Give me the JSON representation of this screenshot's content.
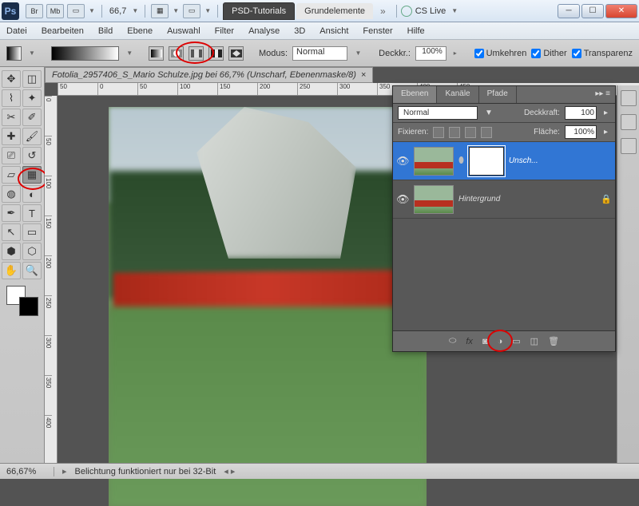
{
  "app": {
    "logo": "Ps"
  },
  "titlebar": {
    "boxes": [
      "Br",
      "Mb"
    ],
    "zoom": "66,7",
    "tabs": {
      "dark": "PSD-Tutorials",
      "light": "Grundelemente"
    },
    "cslive": "CS Live"
  },
  "menu": [
    "Datei",
    "Bearbeiten",
    "Bild",
    "Ebene",
    "Auswahl",
    "Filter",
    "Analyse",
    "3D",
    "Ansicht",
    "Fenster",
    "Hilfe"
  ],
  "optbar": {
    "modus_label": "Modus:",
    "modus_value": "Normal",
    "deckr_label": "Deckkr.:",
    "deckr_value": "100%",
    "cb1": "Umkehren",
    "cb2": "Dither",
    "cb3": "Transparenz"
  },
  "doc": {
    "tab": "Fotolia_2957406_S_Mario Schulze.jpg bei 66,7%  (Unscharf, Ebenenmaske/8)",
    "ruler_h": [
      "50",
      "0",
      "50",
      "100",
      "150",
      "200",
      "250",
      "300",
      "350",
      "400",
      "450"
    ],
    "ruler_v": [
      "0",
      "50",
      "100",
      "150",
      "200",
      "250",
      "300",
      "350",
      "400"
    ]
  },
  "layerspanel": {
    "tabs": [
      "Ebenen",
      "Kanäle",
      "Pfade"
    ],
    "blend": "Normal",
    "opacity_label": "Deckkraft:",
    "opacity_value": "100",
    "lock_label": "Fixieren:",
    "fill_label": "Fläche:",
    "fill_value": "100%",
    "layers": [
      {
        "name": "Unsch..."
      },
      {
        "name": "Hintergrund"
      }
    ]
  },
  "status": {
    "zoom": "66,67%",
    "msg": "Belichtung funktioniert nur bei 32-Bit"
  }
}
